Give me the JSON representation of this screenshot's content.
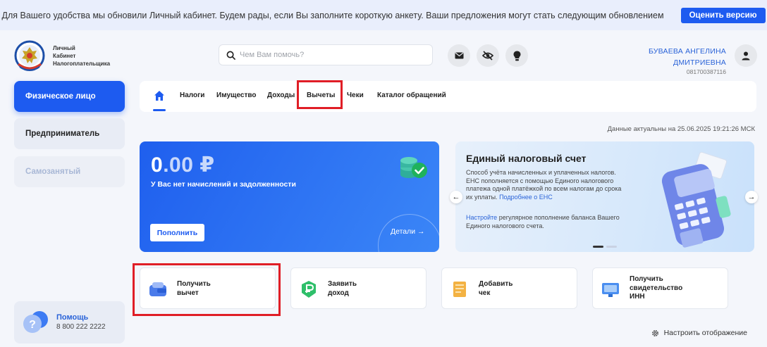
{
  "banner": {
    "text": "Для Вашего удобства мы обновили Личный кабинет. Будем рады, если Вы заполните короткую анкету. Ваши предложения могут стать следующим обновлением",
    "button_label": "Оценить версию"
  },
  "header": {
    "logo_text": [
      "Личный",
      "Кабинет",
      "Налогоплательщика"
    ],
    "search_placeholder": "Чем Вам помочь?",
    "icons": [
      "mail-icon",
      "eye-off-icon",
      "lightbulb-icon"
    ],
    "user": {
      "name_line1": "БУВАЕВА АНГЕЛИНА",
      "name_line2": "ДМИТРИЕВНА",
      "inn": "081700387116"
    }
  },
  "sidebar": {
    "items": [
      {
        "label": "Физическое лицо",
        "state": "active"
      },
      {
        "label": "Предприниматель",
        "state": "normal"
      },
      {
        "label": "Самозанятый",
        "state": "disabled"
      }
    ],
    "help": {
      "title": "Помощь",
      "phone": "8 800 222 2222"
    }
  },
  "nav": {
    "items": [
      "Налоги",
      "Имущество",
      "Доходы",
      "Вычеты",
      "Чеки",
      "Каталог обращений"
    ],
    "active": "home"
  },
  "data_actual": "Данные актуальны на 25.06.2025 19:21:26 МСК",
  "balance": {
    "amount_int": "0",
    "amount_dec": ".00 ₽",
    "subtitle": "У Вас нет начислений и задолженности",
    "pay_label": "Пополнить",
    "details_label": "Детали"
  },
  "ens": {
    "title": "Единый налоговый счет",
    "text": "Способ учёта начисленных и уплаченных налогов. ЕНС пополняется с помощью Единого налогового платежа одной платёжкой по всем налогам до срока их уплаты.",
    "more_link": "Подробнее о ЕНС",
    "text2_link": "Настройте",
    "text2": " регулярное пополнение баланса Вашего Единого налогового счета."
  },
  "cards": [
    {
      "line1": "Получить",
      "line2": "вычет",
      "icon": "deduction-icon"
    },
    {
      "line1": "Заявить",
      "line2": "доход",
      "icon": "income-icon"
    },
    {
      "line1": "Добавить",
      "line2": "чек",
      "icon": "receipt-icon"
    },
    {
      "line1": "Получить",
      "line2": "свидетельство",
      "line3": "ИНН",
      "icon": "certificate-icon"
    }
  ],
  "configure_label": "Настроить отображение",
  "colors": {
    "accent": "#1d5bf0",
    "highlight": "#e01e26",
    "link": "#2a63d8"
  }
}
